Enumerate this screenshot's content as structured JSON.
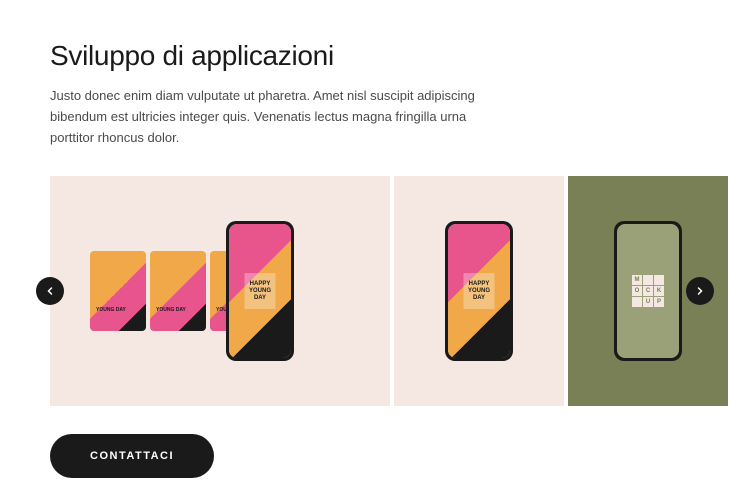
{
  "header": {
    "title": "Sviluppo di applicazioni",
    "description": "Justo donec enim diam vulputate ut pharetra. Amet nisl suscipit adipiscing bibendum est ultricies integer quis. Venenatis lectus magna fringilla urna porttitor rhoncus dolor."
  },
  "carousel": {
    "slides": [
      {
        "card_text": "YOUNG DAY",
        "phone_text": "HAPPY YOUNG DAY"
      },
      {
        "phone_text": "HAPPY YOUNG DAY"
      },
      {
        "mockup_letters": [
          "M",
          "",
          "",
          "O",
          "C",
          "K",
          "",
          "U",
          "P"
        ]
      }
    ],
    "prev_icon": "chevron-left",
    "next_icon": "chevron-right"
  },
  "cta": {
    "label": "Contattaci"
  },
  "colors": {
    "dark": "#1a1a1a",
    "beige": "#f5e8e2",
    "olive": "#7a8055",
    "pink": "#e8548c",
    "orange": "#f0a848"
  }
}
